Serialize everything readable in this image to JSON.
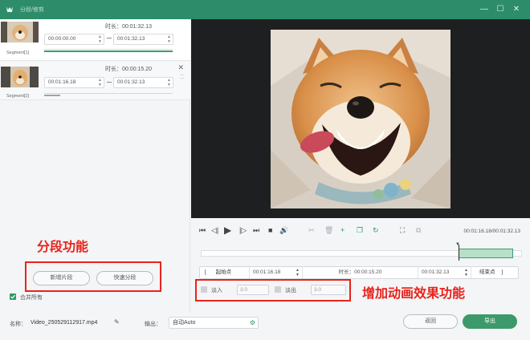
{
  "app": {
    "title": "分段/修剪"
  },
  "window_controls": {
    "minimize": "—",
    "maximize": "☐",
    "close": "✕"
  },
  "segments": [
    {
      "label": "Segment[1]",
      "duration": "时长：00:01:32.13",
      "start": "00:00:00.00",
      "end": "00:01:32.13"
    },
    {
      "label": "Segment[2]",
      "duration": "时长：00:00:15.20",
      "start": "00:01:16.18",
      "end": "00:01:32.13"
    }
  ],
  "left_actions": {
    "new_segment": "新增片段",
    "quick_split": "快速分段",
    "merge_all": "合并所有"
  },
  "annotations": {
    "split_feature": "分段功能",
    "animation_feature": "增加动画效果功能"
  },
  "player": {
    "timecode": "00:01:16.18/00:01:32.13"
  },
  "trim": {
    "start_button": "起始点",
    "start_value": "00:01:16.18",
    "duration": "时长：00:00:15.20",
    "end_value": "00:01:32.13",
    "end_button": "结束点"
  },
  "fade": {
    "fade_in_label": "淡入",
    "fade_in_value": "3.0",
    "fade_out_label": "淡出",
    "fade_out_value": "3.0"
  },
  "bottom": {
    "name_label": "名称：",
    "file_name": "Video_250529112917.mp4",
    "output_label": "输出：",
    "output_value": "自动Auto",
    "back": "返回",
    "export": "导出"
  },
  "colors": {
    "accent": "#2d8c6a",
    "annotation": "#e8231c",
    "export_button": "#3c9a6a"
  }
}
